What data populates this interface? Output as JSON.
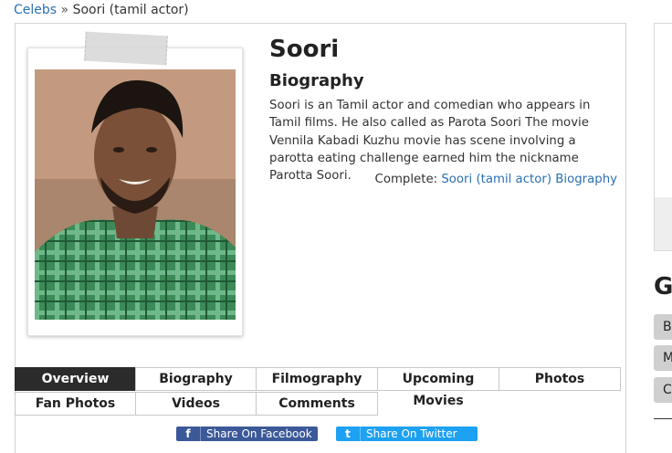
{
  "breadcrumb": {
    "root": "Celebs",
    "separator": "»",
    "current": "Soori (tamil actor)"
  },
  "profile": {
    "name": "Soori",
    "section_heading": "Biography",
    "bio": "Soori is an Tamil actor and comedian who appears in Tamil films. He also called as Parota Soori The movie Vennila Kabadi Kuzhu movie has scene involving a parotta eating challenge earned him the nickname Parotta Soori.",
    "complete_prefix": "Complete:",
    "complete_link": "Soori (tamil actor) Biography"
  },
  "tabs": [
    {
      "label": "Overview",
      "active": true
    },
    {
      "label": "Biography",
      "active": false
    },
    {
      "label": "Filmography",
      "active": false
    },
    {
      "label": "Upcoming Movies",
      "active": false
    },
    {
      "label": "Photos",
      "active": false
    },
    {
      "label": "Fan Photos",
      "active": false
    },
    {
      "label": "Videos",
      "active": false
    },
    {
      "label": "Comments",
      "active": false
    }
  ],
  "share": {
    "facebook_label": "Share On Facebook",
    "facebook_icon": "f",
    "twitter_label": "Share On Twitter",
    "twitter_icon": "t"
  },
  "sidebar": {
    "heading": "G",
    "chips": [
      "B",
      "M",
      "Ce"
    ]
  },
  "colors": {
    "link": "#2a6fb5",
    "active_tab": "#2b2b2b",
    "facebook": "#3b5998",
    "twitter": "#1da1f2"
  }
}
